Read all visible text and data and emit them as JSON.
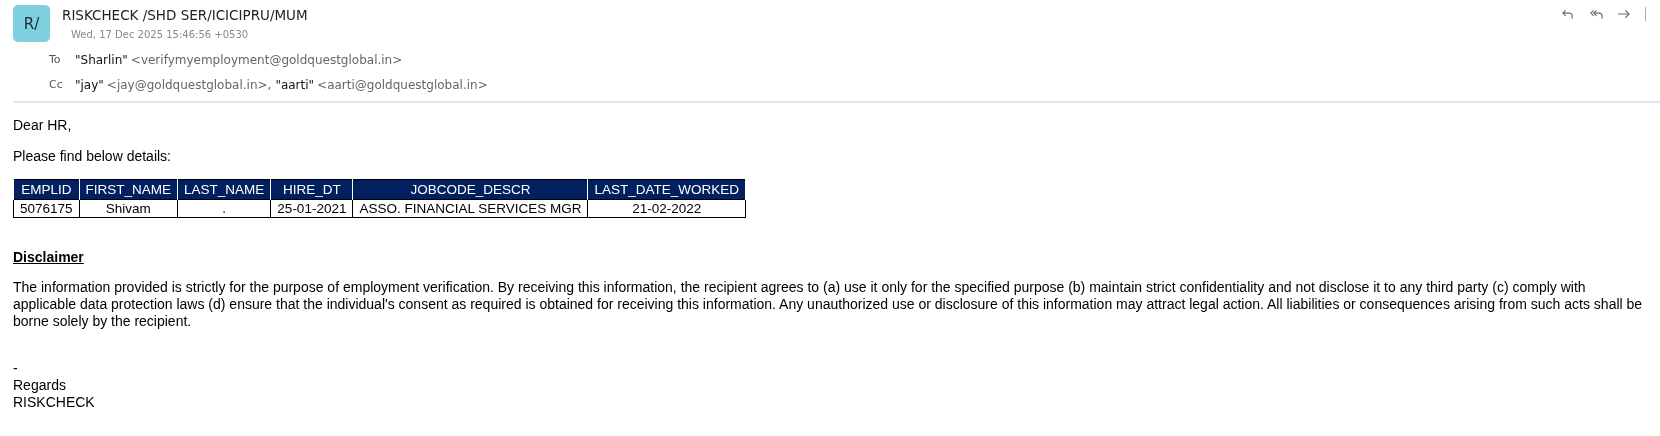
{
  "header": {
    "avatar": "R/",
    "subject": "RISKCHECK /SHD SER/ICICIPRU/MUM",
    "date": "Wed, 17 Dec 2025 15:46:56 +0530",
    "recipients": [
      {
        "label": "To",
        "people": [
          {
            "name": "\"Sharlin\"",
            "address": "<verifymyemployment@goldquestglobal.in>"
          }
        ]
      },
      {
        "label": "Cc",
        "people": [
          {
            "name": "\"jay\"",
            "address": "<jay@goldquestglobal.in>,"
          },
          {
            "name": "\"aarti\"",
            "address": "<aarti@goldquestglobal.in>"
          }
        ]
      }
    ]
  },
  "body": {
    "greeting": "Dear HR,",
    "intro": "Please find below details:",
    "table": {
      "columns": [
        "EMPLID",
        "FIRST_NAME",
        "LAST_NAME",
        "HIRE_DT",
        "JOBCODE_DESCR",
        "LAST_DATE_WORKED"
      ],
      "rows": [
        [
          "5076175",
          "Shivam",
          ".",
          "25-01-2021",
          "ASSO. FINANCIAL SERVICES MGR",
          "21-02-2022"
        ]
      ]
    },
    "disclaimer_title": "Disclaimer",
    "disclaimer": "The information provided is strictly for the purpose of employment verification. By receiving this information, the recipient agrees to (a) use it only for the specified purpose (b) maintain strict confidentiality and not disclose it to any third party (c) comply with applicable data protection laws (d) ensure that the individual's consent as required is obtained for receiving this information. Any unauthorized use or disclosure of this information may attract legal action. All liabilities or consequences arising from such acts shall be borne solely by the recipient.",
    "signature": [
      "-",
      "Regards",
      "RISKCHECK"
    ]
  }
}
